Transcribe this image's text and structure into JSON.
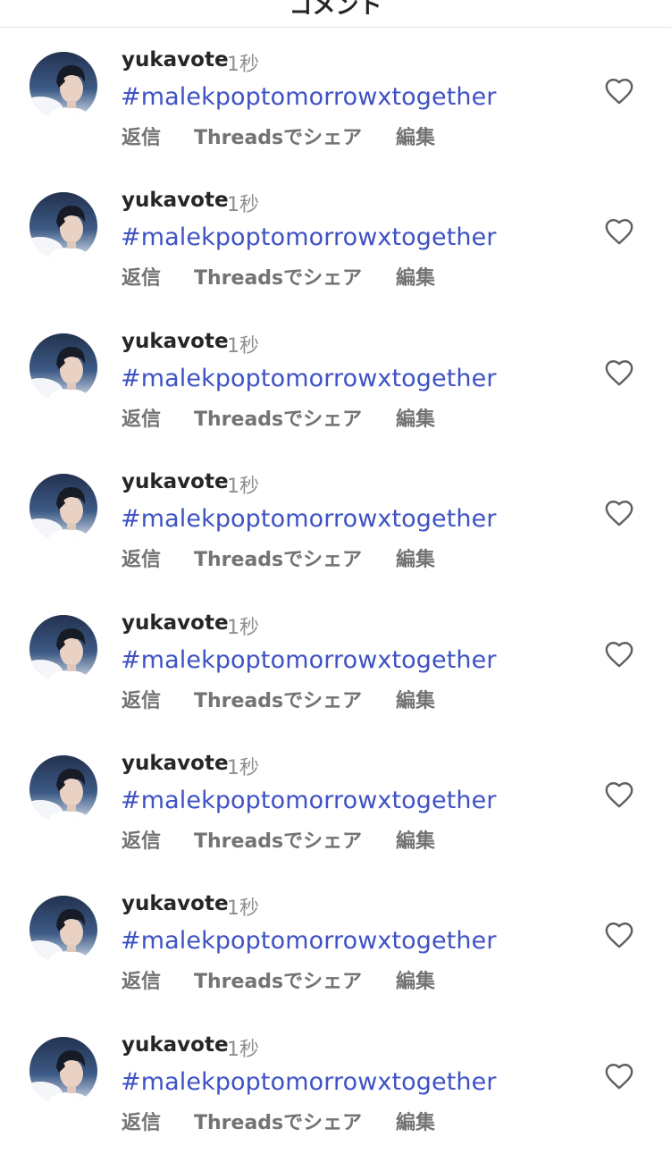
{
  "header": {
    "title": "コメント"
  },
  "comments": [
    {
      "username": "yukavote",
      "time": "1秒",
      "text": "#malekpoptomorrowxtogether",
      "actions": {
        "reply": "返信",
        "share": "Threadsでシェア",
        "edit": "編集"
      }
    },
    {
      "username": "yukavote",
      "time": "1秒",
      "text": "#malekpoptomorrowxtogether",
      "actions": {
        "reply": "返信",
        "share": "Threadsでシェア",
        "edit": "編集"
      }
    },
    {
      "username": "yukavote",
      "time": "1秒",
      "text": "#malekpoptomorrowxtogether",
      "actions": {
        "reply": "返信",
        "share": "Threadsでシェア",
        "edit": "編集"
      }
    },
    {
      "username": "yukavote",
      "time": "1秒",
      "text": "#malekpoptomorrowxtogether",
      "actions": {
        "reply": "返信",
        "share": "Threadsでシェア",
        "edit": "編集"
      }
    },
    {
      "username": "yukavote",
      "time": "1秒",
      "text": "#malekpoptomorrowxtogether",
      "actions": {
        "reply": "返信",
        "share": "Threadsでシェア",
        "edit": "編集"
      }
    },
    {
      "username": "yukavote",
      "time": "1秒",
      "text": "#malekpoptomorrowxtogether",
      "actions": {
        "reply": "返信",
        "share": "Threadsでシェア",
        "edit": "編集"
      }
    },
    {
      "username": "yukavote",
      "time": "1秒",
      "text": "#malekpoptomorrowxtogether",
      "actions": {
        "reply": "返信",
        "share": "Threadsでシェア",
        "edit": "編集"
      }
    },
    {
      "username": "yukavote",
      "time": "1秒",
      "text": "#malekpoptomorrowxtogether",
      "actions": {
        "reply": "返信",
        "share": "Threadsでシェア",
        "edit": "編集"
      }
    }
  ],
  "icons": {
    "like": "heart-outline-icon",
    "avatar": "profile-photo"
  },
  "colors": {
    "hashtag": "#3e52c4",
    "username": "#262626",
    "muted": "#737373",
    "time": "#8e8e8e",
    "divider": "#e6e6e6"
  }
}
